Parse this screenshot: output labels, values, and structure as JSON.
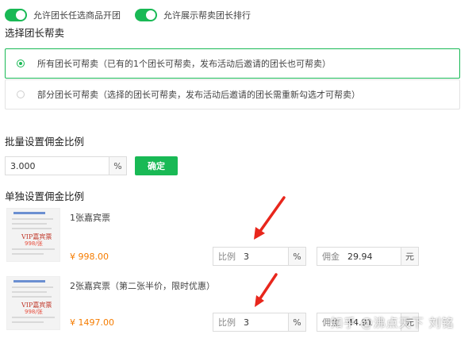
{
  "toggles": [
    {
      "label": "允许团长任选商品开团",
      "on": true
    },
    {
      "label": "允许展示帮卖团长排行",
      "on": true
    }
  ],
  "select_section": {
    "title": "选择团长帮卖",
    "options": [
      {
        "label": "所有团长可帮卖（已有的1个团长可帮卖，发布活动后邀请的团长也可帮卖）",
        "selected": true
      },
      {
        "label": "部分团长可帮卖（选择的团长可帮卖，发布活动后邀请的团长需重新勾选才可帮卖）",
        "selected": false
      }
    ]
  },
  "batch": {
    "title": "批量设置佣金比例",
    "value": "3.000",
    "unit": "%",
    "confirm_label": "确定"
  },
  "single": {
    "title": "单独设置佣金比例",
    "products": [
      {
        "name": "1张嘉宾票",
        "price": "¥ 998.00",
        "ratio_label": "比例",
        "ratio_value": "3",
        "ratio_unit": "%",
        "commission_label": "佣金",
        "commission_value": "29.94",
        "commission_unit": "元"
      },
      {
        "name": "2张嘉宾票（第二张半价，限时优惠）",
        "price": "¥ 1497.00",
        "ratio_label": "比例",
        "ratio_value": "3",
        "ratio_unit": "%",
        "commission_label": "佣金",
        "commission_value": "44.91",
        "commission_unit": "元"
      }
    ],
    "thumb_text": {
      "vip": "VIP嘉宾票",
      "tag": "998/张"
    }
  },
  "watermark": "知乎 @沸点天下 刘铭",
  "colors": {
    "accent": "#19b955",
    "price": "#f57c00",
    "arrow": "#e8261c"
  }
}
